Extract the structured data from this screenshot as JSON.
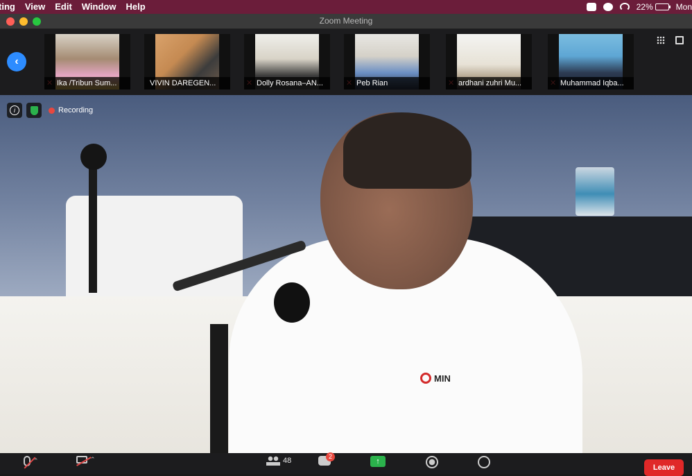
{
  "menubar": {
    "app_name": "ting",
    "items": [
      "View",
      "Edit",
      "Window",
      "Help"
    ],
    "battery": "22%",
    "clock": "Mon"
  },
  "window": {
    "title": "Zoom Meeting"
  },
  "participants": [
    {
      "name": "Ika /Tribun Sum...",
      "muted": true
    },
    {
      "name": "VIVIN DAREGEN...",
      "muted": false
    },
    {
      "name": "Dolly Rosana–AN...",
      "muted": true
    },
    {
      "name": "Peb Rian",
      "muted": true
    },
    {
      "name": "ardhani zuhri Mu...",
      "muted": true
    },
    {
      "name": "Muhammad Iqba...",
      "muted": true
    }
  ],
  "stage": {
    "recording_label": "Recording",
    "shirt_logo": "MIN"
  },
  "toolbar": {
    "participants_count": "48",
    "chat_badge": "2",
    "leave_label": "Leave"
  },
  "colors": {
    "menubar_bg": "#6b1d3a",
    "accent_blue": "#2d8cff",
    "recording_red": "#e8483f",
    "leave_red": "#e02828",
    "share_green": "#2bb24c"
  }
}
